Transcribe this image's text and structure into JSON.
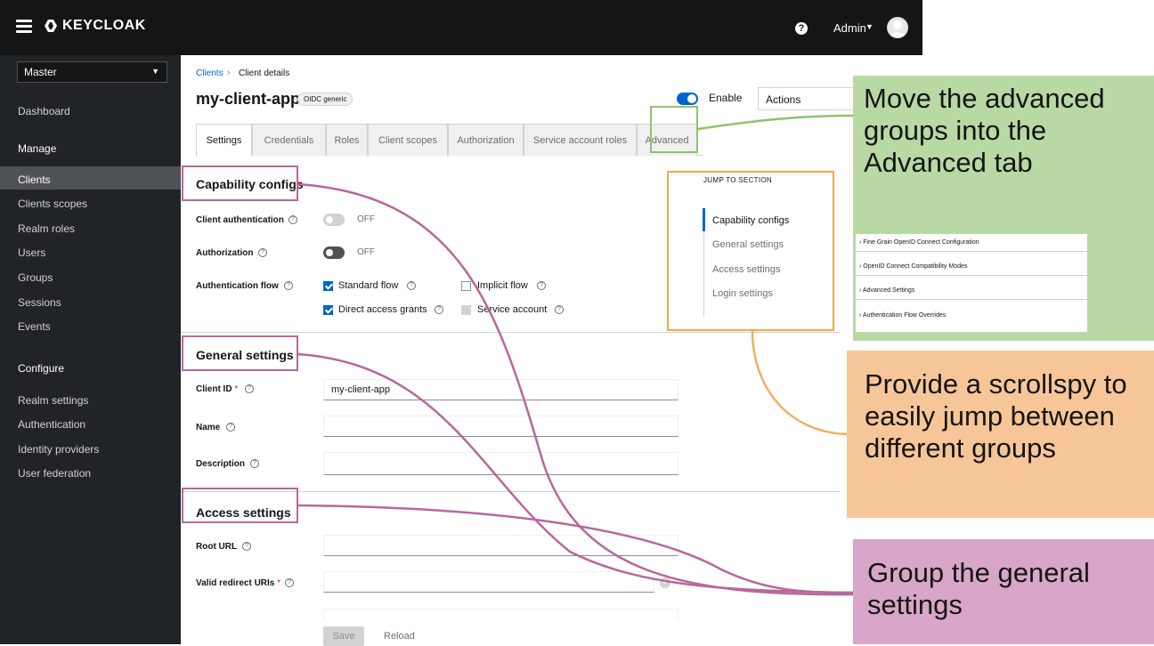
{
  "masthead": {
    "logo_text": "KEYCLOAK",
    "user_name": "Admin",
    "help_glyph": "?"
  },
  "sidebar": {
    "realm": "Master",
    "dashboard": "Dashboard",
    "manage_heading": "Manage",
    "manage_items": [
      "Clients",
      "Clients scopes",
      "Realm roles",
      "Users",
      "Groups",
      "Sessions",
      "Events"
    ],
    "configure_heading": "Configure",
    "configure_items": [
      "Realm settings",
      "Authentication",
      "Identity providers",
      "User federation"
    ],
    "active_item": "Clients"
  },
  "breadcrumb": {
    "link": "Clients",
    "separator": "›",
    "current": "Client details"
  },
  "header": {
    "title": "my-client-app",
    "badge": "OIDC generic",
    "enable_label": "Enable",
    "enabled": true,
    "actions_label": "Actions"
  },
  "tabs": [
    "Settings",
    "Credentials",
    "Roles",
    "Client scopes",
    "Authorization",
    "Service account roles",
    "Advanced"
  ],
  "active_tab": "Settings",
  "capability": {
    "title": "Capability configs",
    "client_auth_label": "Client authentication",
    "client_auth_state": "OFF",
    "authorization_label": "Authorization",
    "authorization_state": "OFF",
    "auth_flow_label": "Authentication flow",
    "flows": {
      "standard": {
        "label": "Standard flow",
        "checked": true
      },
      "implicit": {
        "label": "Implicit flow",
        "checked": false
      },
      "direct": {
        "label": "Direct access grants",
        "checked": true
      },
      "service": {
        "label": "Service account",
        "checked": false,
        "disabled": true
      }
    }
  },
  "general": {
    "title": "General settings",
    "client_id_label": "Client ID",
    "client_id_value": "my-client-app",
    "name_label": "Name",
    "name_value": "",
    "description_label": "Description",
    "description_value": ""
  },
  "access": {
    "title": "Access settings",
    "root_url_label": "Root URL",
    "root_url_value": "",
    "redirect_label": "Valid redirect URIs",
    "redirect_value": ""
  },
  "jump": {
    "title": "JUMP TO SECTION",
    "items": [
      "Capability configs",
      "General settings",
      "Access settings",
      "Login settings"
    ],
    "active": "Capability configs"
  },
  "footer": {
    "save": "Save",
    "reload": "Reload"
  },
  "annotations": {
    "green_text": "Move the advanced groups into the Advanced tab",
    "orange_text": "Provide a scrollspy to easily jump between different groups",
    "pink_text": "Group the general settings",
    "advanced_groups": [
      "› Fine Grain OpenID Connect Configuration",
      "› OpenID Connect Compatibility Modes",
      "› Advanced Settings",
      "› Authentication Flow Overrides"
    ],
    "colors": {
      "green": "#b9d9a4",
      "orange": "#f7c698",
      "pink": "#d8a6c8",
      "green_line": "#8cc46e",
      "orange_line": "#f0b060",
      "pink_line": "#b9679a"
    }
  },
  "icons": {
    "hamburger": "hamburger-menu-icon",
    "logo": "keycloak-logo-icon",
    "help": "help-circle-icon",
    "avatar": "user-avatar-icon",
    "add": "plus-circle-icon"
  }
}
